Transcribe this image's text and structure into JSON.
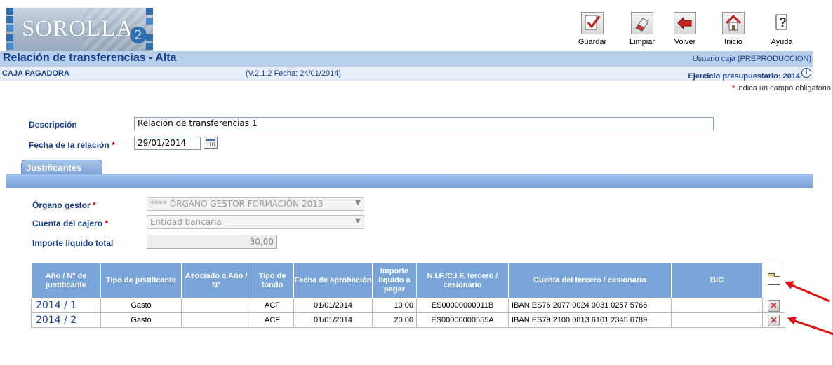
{
  "app": {
    "logo_text": "SOROLLA",
    "logo_suffix": "2"
  },
  "toolbar": {
    "guardar": "Guardar",
    "limpiar": "Limpiar",
    "volver": "Volver",
    "inicio": "Inicio",
    "ayuda": "Ayuda"
  },
  "header": {
    "title": "Relación de transferencias - Alta",
    "user": "Usuario caja (PREPRODUCCION)",
    "caja": "CAJA PAGADORA",
    "version": "(V.2.1.2 Fecha: 24/01/2014)",
    "ejercicio": "Ejercicio presupuestario: 2014",
    "required_note": "indica un campo obligatorio",
    "required_mark": "*"
  },
  "form": {
    "descripcion_label": "Descripción",
    "descripcion_value": "Relación de transferencias 1",
    "fecha_label": "Fecha de la relación",
    "fecha_value": "29/01/2014"
  },
  "tabs": {
    "justificantes": "Justificantes"
  },
  "justificantes": {
    "organo_label": "Órgano gestor",
    "organo_value": "**** ÓRGANO GESTOR FORMACIÓN 2013",
    "cuenta_label": "Cuenta del cajero",
    "cuenta_value": "Entidad bancaria",
    "importe_label": "Importe líquido total",
    "importe_value": "30,00"
  },
  "table": {
    "headers": [
      "Año / Nº de justificante",
      "Tipo de justificante",
      "Asociado a Año / Nº",
      "Tipo de fondo",
      "Fecha de aprobación",
      "Importe líquido a pagar",
      "N.I.F./C.I.F. tercero / cesionario",
      "Cuenta del tercero / cesionario",
      "BIC"
    ],
    "rows": [
      {
        "justificante": "2014 / 1",
        "tipo": "Gasto",
        "asociado": "",
        "fondo": "ACF",
        "fecha": "01/01/2014",
        "importe": "10,00",
        "nif": "ES00000000011B",
        "cuenta": "IBAN ES76 2077 0024 0031 0257 5766",
        "bic": ""
      },
      {
        "justificante": "2014 / 2",
        "tipo": "Gasto",
        "asociado": "",
        "fondo": "ACF",
        "fecha": "01/01/2014",
        "importe": "20,00",
        "nif": "ES00000000555A",
        "cuenta": "IBAN ES79 2100 0813 6101 2345 6789",
        "bic": ""
      }
    ]
  },
  "colors": {
    "header_blue": "#b9d0ec",
    "table_header": "#7aa5d8",
    "label_blue": "#1a3f8a",
    "required_red": "#e00000",
    "annotation_arrow": "#e01010"
  }
}
